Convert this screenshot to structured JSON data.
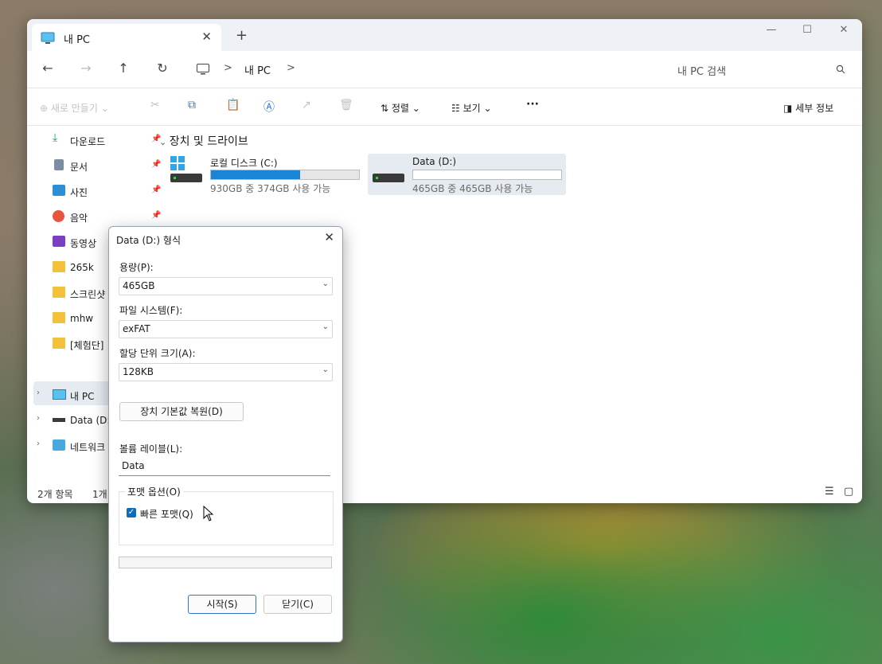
{
  "explorer": {
    "tab_title": "내 PC",
    "tab_close": "✕",
    "new_tab": "+",
    "window_controls": {
      "minimize": "—",
      "maximize": "☐",
      "close": "✕"
    },
    "nav": {
      "back": "←",
      "forward": "→",
      "up": "↑",
      "refresh": "↻"
    },
    "breadcrumb": {
      "sep1": ">",
      "item": "내 PC",
      "sep2": ">"
    },
    "search_placeholder": "내 PC 검색",
    "toolbar": {
      "new": "새로 만들기",
      "sort": "정렬",
      "view": "보기",
      "more": "···",
      "details": "세부 정보"
    },
    "sidebar": {
      "quick": [
        {
          "label": "다운로드",
          "pinned": true
        },
        {
          "label": "문서",
          "pinned": true
        },
        {
          "label": "사진",
          "pinned": true
        },
        {
          "label": "음악",
          "pinned": true
        },
        {
          "label": "동영상",
          "pinned": false
        },
        {
          "label": "265k",
          "pinned": false
        },
        {
          "label": "스크린샷",
          "pinned": false
        },
        {
          "label": "mhw",
          "pinned": false
        },
        {
          "label": "[체험단]",
          "pinned": false
        }
      ],
      "tree": [
        {
          "label": "내 PC"
        },
        {
          "label": "Data (D:)"
        },
        {
          "label": "네트워크"
        }
      ]
    },
    "section_title": "장치 및 드라이브",
    "drives": [
      {
        "name": "로컬 디스크 (C:)",
        "free_text": "930GB 중 374GB 사용 가능",
        "used_fraction": 0.6
      },
      {
        "name": "Data (D:)",
        "free_text": "465GB 중 465GB 사용 가능",
        "used_fraction": 0.0
      }
    ],
    "status": {
      "items": "2개 항목",
      "selected": "1개"
    }
  },
  "dialog": {
    "title": "Data (D:) 형식",
    "close": "✕",
    "capacity_label": "용량(P):",
    "capacity_value": "465GB",
    "fs_label": "파일 시스템(F):",
    "fs_value": "exFAT",
    "alloc_label": "할당 단위 크기(A):",
    "alloc_value": "128KB",
    "restore_button": "장치 기본값 복원(D)",
    "volume_label": "볼륨 레이블(L):",
    "volume_value": "Data",
    "options_label": "포맷 옵션(O)",
    "quick_format_label": "빠른 포맷(Q)",
    "quick_format_checked": true,
    "progress": 0.0,
    "start_button": "시작(S)",
    "close_button": "닫기(C)"
  }
}
